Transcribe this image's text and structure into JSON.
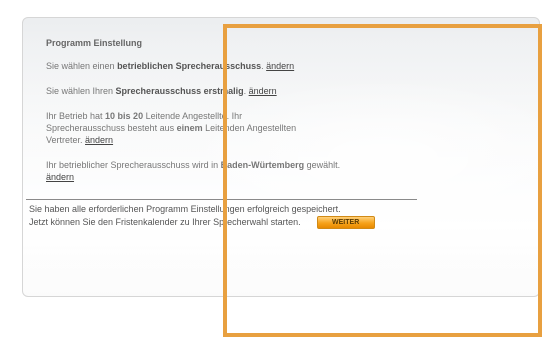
{
  "settings": {
    "title": "Programm Einstellung",
    "line1": {
      "prefix": "Sie wählen einen ",
      "bold": "betrieblichen Sprecherausschuss",
      "suffix": ". ",
      "link": "ändern"
    },
    "line2": {
      "prefix": "Sie wählen Ihren ",
      "bold": "Sprecherausschuss erstmalig",
      "suffix": ". ",
      "link": "ändern"
    },
    "line3": {
      "t1": "Ihr Betrieb hat ",
      "b1": "10 bis 20",
      "t2": " Leitende Angestellte. Ihr Sprecherausschuss besteht aus ",
      "b2": "einem",
      "t3": " Leitenden Angestellten Vertreter. ",
      "link": "ändern"
    },
    "line4": {
      "prefix": "Ihr betrieblicher Sprecherausschuss wird in ",
      "bold": "Baden-Würtemberg",
      "suffix": " gewählt. ",
      "link": "ändern"
    }
  },
  "success": {
    "line1": "Sie haben alle erforderlichen Programm Einstellungen erfolgreich gespeichert.",
    "line2": "Jetzt können Sie den Fristenkalender zu Ihrer Sprecherwahl starten.",
    "button_label": "WEITER"
  },
  "colors": {
    "accent": "#f6a21a",
    "highlight": "#e8a040"
  }
}
